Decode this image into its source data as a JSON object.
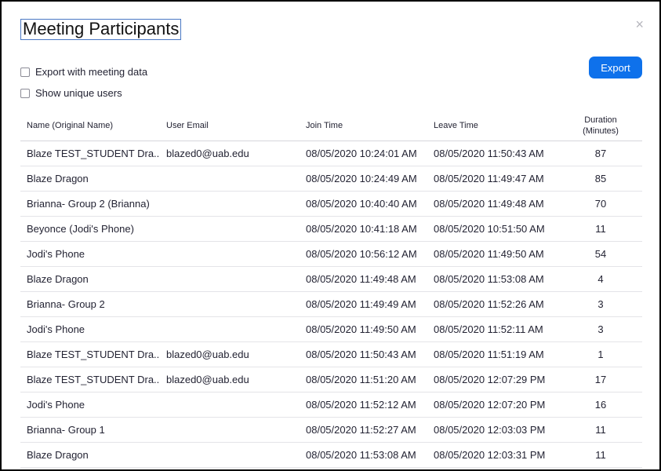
{
  "dialog": {
    "title": "Meeting Participants",
    "close_glyph": "×",
    "export_with_meeting_data": "Export with meeting data",
    "show_unique_users": "Show unique users",
    "export_label": "Export",
    "accent_color": "#0e71eb"
  },
  "table": {
    "headers": {
      "name": "Name (Original Name)",
      "email": "User Email",
      "join": "Join Time",
      "leave": "Leave Time",
      "duration_line1": "Duration",
      "duration_line2": "(Minutes)"
    },
    "rows": [
      {
        "name": "Blaze TEST_STUDENT Dra...",
        "email": "blazed0@uab.edu",
        "join": "08/05/2020 10:24:01 AM",
        "leave": "08/05/2020 11:50:43 AM",
        "duration": "87"
      },
      {
        "name": "Blaze Dragon",
        "email": "",
        "join": "08/05/2020 10:24:49 AM",
        "leave": "08/05/2020 11:49:47 AM",
        "duration": "85"
      },
      {
        "name": "Brianna- Group 2 (Brianna)",
        "email": "",
        "join": "08/05/2020 10:40:40 AM",
        "leave": "08/05/2020 11:49:48 AM",
        "duration": "70"
      },
      {
        "name": "Beyonce (Jodi's Phone)",
        "email": "",
        "join": "08/05/2020 10:41:18 AM",
        "leave": "08/05/2020 10:51:50 AM",
        "duration": "11"
      },
      {
        "name": "Jodi's Phone",
        "email": "",
        "join": "08/05/2020 10:56:12 AM",
        "leave": "08/05/2020 11:49:50 AM",
        "duration": "54"
      },
      {
        "name": "Blaze Dragon",
        "email": "",
        "join": "08/05/2020 11:49:48 AM",
        "leave": "08/05/2020 11:53:08 AM",
        "duration": "4"
      },
      {
        "name": "Brianna- Group 2",
        "email": "",
        "join": "08/05/2020 11:49:49 AM",
        "leave": "08/05/2020 11:52:26 AM",
        "duration": "3"
      },
      {
        "name": "Jodi's Phone",
        "email": "",
        "join": "08/05/2020 11:49:50 AM",
        "leave": "08/05/2020 11:52:11 AM",
        "duration": "3"
      },
      {
        "name": "Blaze TEST_STUDENT Dra...",
        "email": "blazed0@uab.edu",
        "join": "08/05/2020 11:50:43 AM",
        "leave": "08/05/2020 11:51:19 AM",
        "duration": "1"
      },
      {
        "name": "Blaze TEST_STUDENT Dra...",
        "email": "blazed0@uab.edu",
        "join": "08/05/2020 11:51:20 AM",
        "leave": "08/05/2020 12:07:29 PM",
        "duration": "17"
      },
      {
        "name": "Jodi's Phone",
        "email": "",
        "join": "08/05/2020 11:52:12 AM",
        "leave": "08/05/2020 12:07:20 PM",
        "duration": "16"
      },
      {
        "name": "Brianna- Group 1",
        "email": "",
        "join": "08/05/2020 11:52:27 AM",
        "leave": "08/05/2020 12:03:03 PM",
        "duration": "11"
      },
      {
        "name": "Blaze Dragon",
        "email": "",
        "join": "08/05/2020 11:53:08 AM",
        "leave": "08/05/2020 12:03:31 PM",
        "duration": "11"
      }
    ]
  }
}
